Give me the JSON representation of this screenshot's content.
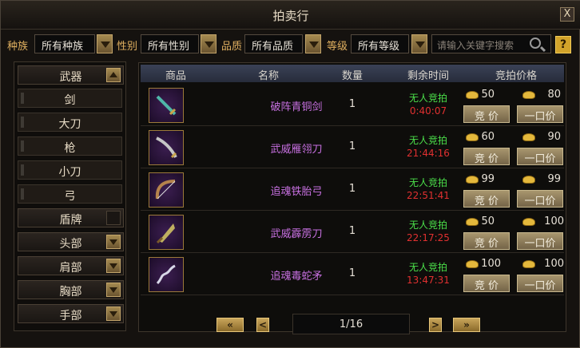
{
  "window": {
    "title": "拍卖行",
    "close_label": "X"
  },
  "filters": [
    {
      "label": "种族",
      "value": "所有种族"
    },
    {
      "label": "性别",
      "value": "所有性别"
    },
    {
      "label": "品质",
      "value": "所有品质"
    },
    {
      "label": "等级",
      "value": "所有等级"
    }
  ],
  "search": {
    "placeholder": "请输入关键字搜索",
    "help_label": "?"
  },
  "sidebar": {
    "weapons": "武器",
    "sub_items": [
      "剑",
      "大刀",
      "枪",
      "小刀",
      "弓"
    ],
    "shield": "盾牌",
    "categories": [
      "头部",
      "肩部",
      "胸部",
      "手部"
    ]
  },
  "table": {
    "headers": [
      "商品",
      "名称",
      "数量",
      "剩余时间",
      "竞拍价格"
    ],
    "rows": [
      {
        "name": "破阵青铜剑",
        "qty": "1",
        "status": "无人竞拍",
        "time": "0:40:07",
        "bid": "50",
        "buyout": "80",
        "bid_btn": "竞 价",
        "buy_btn": "一口价",
        "icon": "sword-icon"
      },
      {
        "name": "武威雁翎刀",
        "qty": "1",
        "status": "无人竞拍",
        "time": "21:44:16",
        "bid": "60",
        "buyout": "90",
        "bid_btn": "竞 价",
        "buy_btn": "一口价",
        "icon": "saber-icon"
      },
      {
        "name": "追魂铁胎弓",
        "qty": "1",
        "status": "无人竞拍",
        "time": "22:51:41",
        "bid": "99",
        "buyout": "99",
        "bid_btn": "竞 价",
        "buy_btn": "一口价",
        "icon": "bow-icon"
      },
      {
        "name": "武威霹雳刀",
        "qty": "1",
        "status": "无人竞拍",
        "time": "22:17:25",
        "bid": "50",
        "buyout": "100",
        "bid_btn": "竞 价",
        "buy_btn": "一口价",
        "icon": "blade-icon"
      },
      {
        "name": "追魂毒蛇矛",
        "qty": "1",
        "status": "无人竞拍",
        "time": "13:47:31",
        "bid": "100",
        "buyout": "100",
        "bid_btn": "竞 价",
        "buy_btn": "一口价",
        "icon": "spear-icon"
      }
    ]
  },
  "pager": {
    "page": "1/16",
    "first": "«",
    "prev": "<",
    "next": ">",
    "last": "»"
  },
  "colors": {
    "name": "#c770e0",
    "status": "#4be04a",
    "time": "#e03030",
    "accent": "#e0b060"
  }
}
